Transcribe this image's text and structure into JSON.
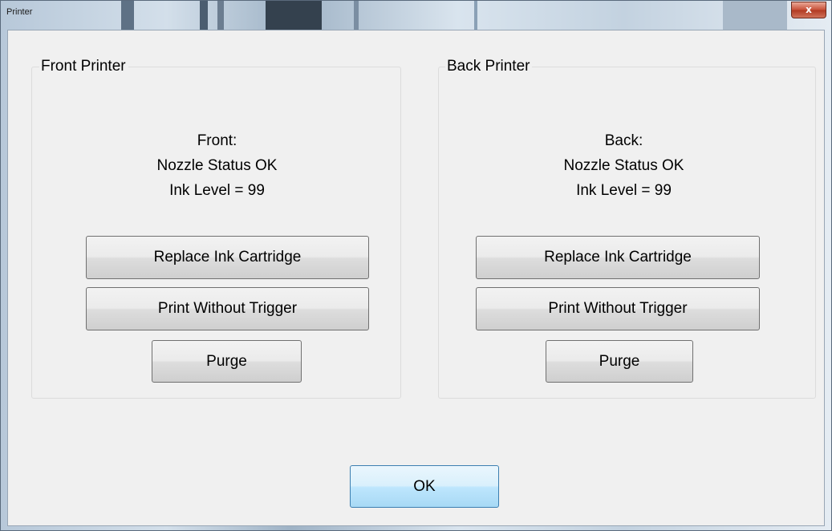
{
  "window": {
    "title": "Printer",
    "close_glyph": "x"
  },
  "front": {
    "group_title": "Front Printer",
    "status_line1": "Front:",
    "status_line2": "Nozzle Status OK",
    "status_line3": "Ink Level = 99",
    "replace_label": "Replace Ink Cartridge",
    "print_label": "Print Without Trigger",
    "purge_label": "Purge"
  },
  "back": {
    "group_title": "Back Printer",
    "status_line1": "Back:",
    "status_line2": "Nozzle Status OK",
    "status_line3": "Ink Level = 99",
    "replace_label": "Replace Ink Cartridge",
    "print_label": "Print Without Trigger",
    "purge_label": "Purge"
  },
  "footer": {
    "ok_label": "OK"
  }
}
